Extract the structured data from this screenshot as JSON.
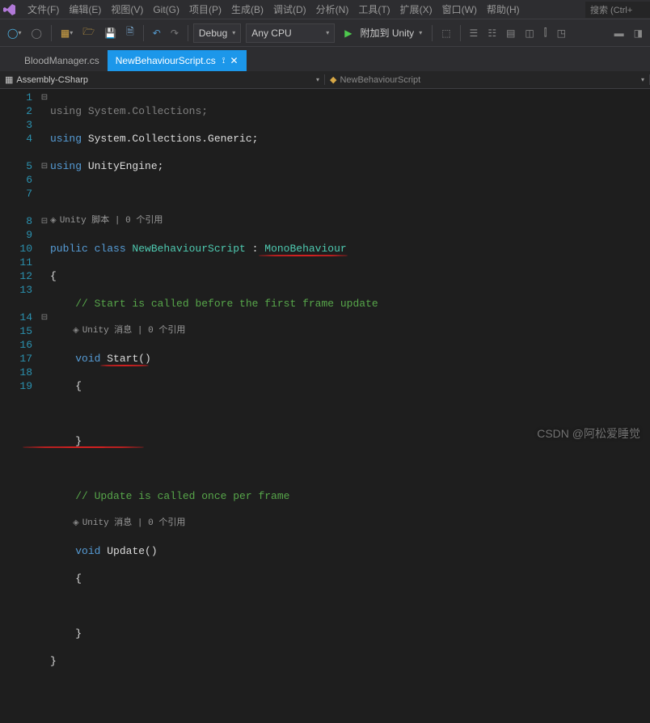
{
  "menu": {
    "items": [
      "文件(F)",
      "编辑(E)",
      "视图(V)",
      "Git(G)",
      "项目(P)",
      "生成(B)",
      "调试(D)",
      "分析(N)",
      "工具(T)",
      "扩展(X)",
      "窗口(W)",
      "帮助(H)"
    ],
    "search_placeholder": "搜索 (Ctrl+"
  },
  "toolbar": {
    "config": "Debug",
    "platform": "Any CPU",
    "run_label": "附加到 Unity"
  },
  "tabs": {
    "inactive": "BloodManager.cs",
    "active": "NewBehaviourScript.cs"
  },
  "nav": {
    "left": "Assembly-CSharp",
    "right": "NewBehaviourScript"
  },
  "code": {
    "l1_using": "using",
    "l1_ns": " System.Collections;",
    "l2_using": "using",
    "l2_ns": " System.Collections.Generic;",
    "l3_using": "using",
    "l3_ns": " UnityEngine;",
    "lens1": "Unity 脚本 | 0 个引用",
    "l5_kw": "public class ",
    "l5_cls": "NewBehaviourScript",
    "l5_colon": " : ",
    "l5_base": "MonoBehaviour",
    "l6": "{",
    "l7_cmt": "// Start is called before the first frame update",
    "lens2": "Unity 消息 | 0 个引用",
    "l8_kw": "void",
    "l8_name": " Start()",
    "l9": "{",
    "l11": "}",
    "l13_cmt": "// Update is called once per frame",
    "lens3": "Unity 消息 | 0 个引用",
    "l14_kw": "void",
    "l14_name": " Update()",
    "l15": "{",
    "l17": "}",
    "l18": "}"
  },
  "line_numbers": [
    "1",
    "2",
    "3",
    "4",
    "",
    "5",
    "6",
    "7",
    "",
    "8",
    "9",
    "10",
    "11",
    "12",
    "13",
    "",
    "14",
    "15",
    "16",
    "17",
    "18",
    "19"
  ],
  "watermark": "CSDN @阿松爱睡觉"
}
